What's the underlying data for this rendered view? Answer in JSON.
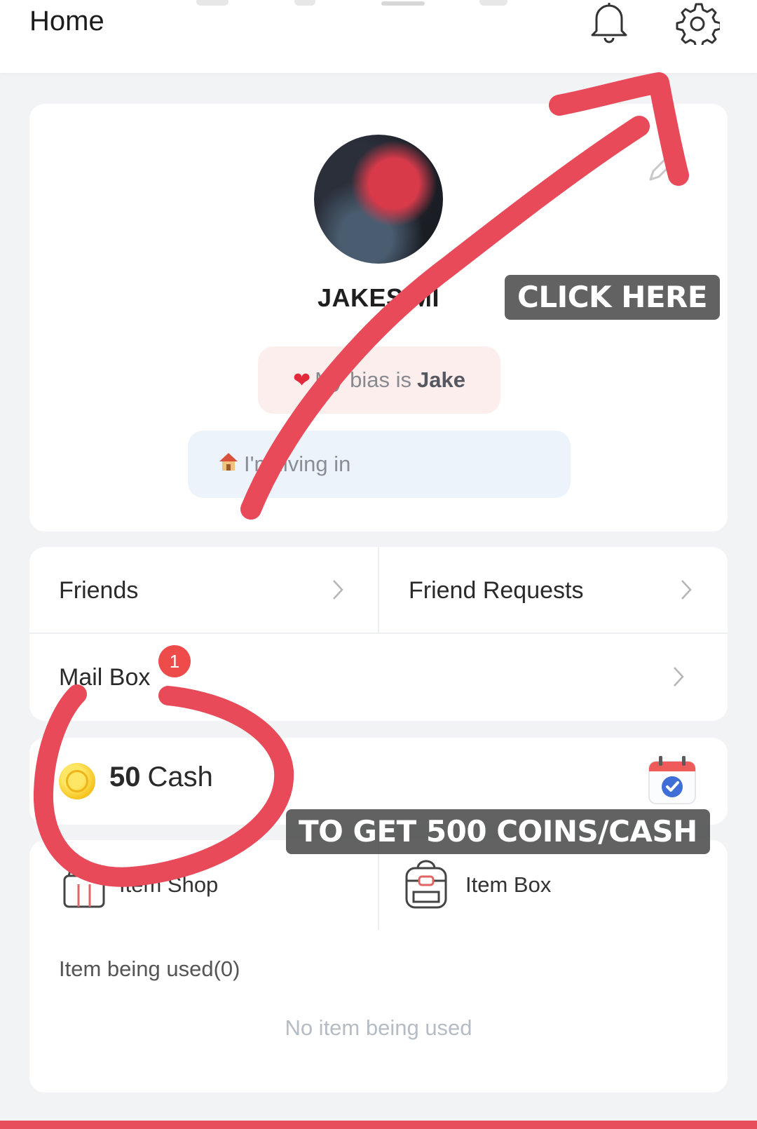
{
  "header": {
    "title": "Home",
    "bell_icon": "bell-icon",
    "settings_icon": "gear-icon"
  },
  "profile": {
    "username": "JAKESIMI",
    "bias_prefix": "My bias is",
    "bias_name": "Jake",
    "living_text": "I'm living in"
  },
  "menu": {
    "friends": "Friends",
    "friend_requests": "Friend Requests",
    "mail_box": "Mail Box",
    "mail_badge": "1"
  },
  "cash": {
    "amount": "50",
    "unit": "Cash"
  },
  "shop": {
    "item_shop": "Item Shop",
    "item_box": "Item Box"
  },
  "items_used": {
    "title": "Item being used(0)",
    "empty_text": "No item being used"
  },
  "annotations": {
    "click_here": "CLICK HERE",
    "to_get": "TO GET 500 COINS/CASH",
    "color": "#e84a5a"
  }
}
